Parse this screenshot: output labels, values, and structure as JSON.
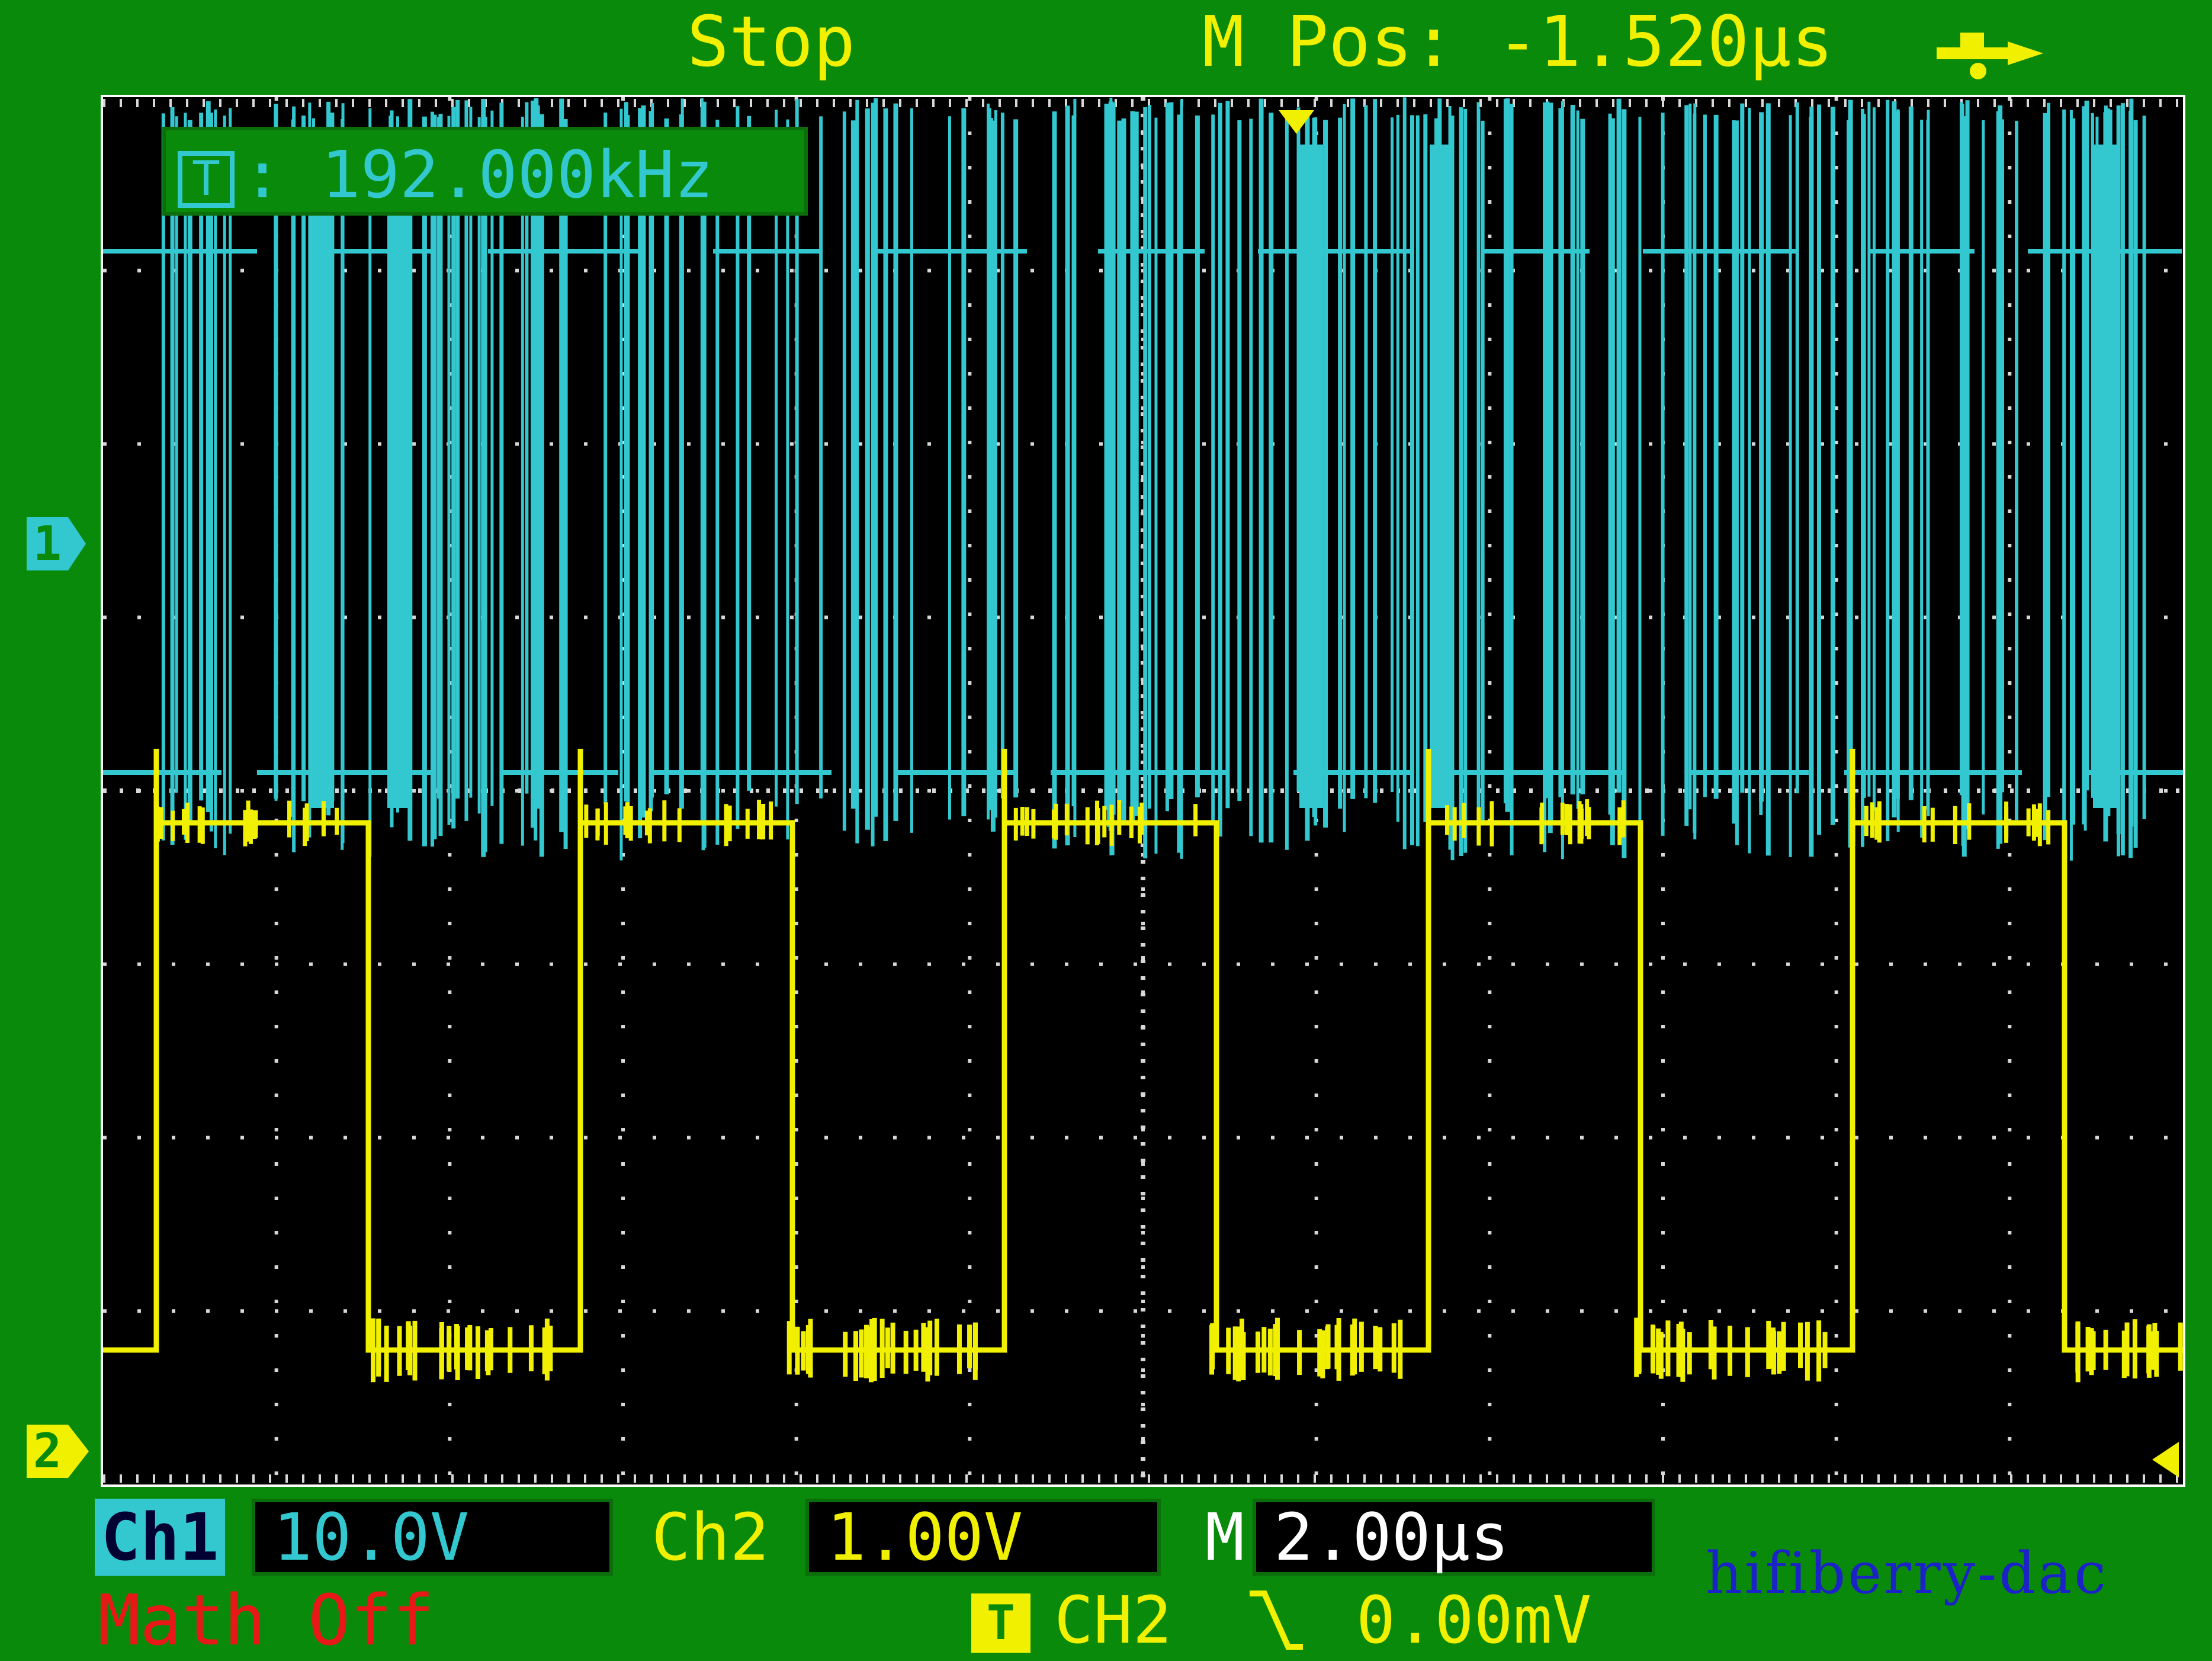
{
  "header": {
    "run_state": "Stop",
    "m_pos": "M Pos: -1.520µs",
    "usb_icon": "usb-icon"
  },
  "screen": {
    "freq_mark": "T",
    "freq_sep": ":",
    "frequency": "192.000kHz",
    "ch1_marker": "1",
    "ch2_marker": "2",
    "trigger_pos_icon": "trigger-position-arrow-icon",
    "trigger_level_icon": "trigger-level-arrow-icon"
  },
  "footer": {
    "ch1_label": "Ch1",
    "ch1_scale": "10.0V",
    "ch2_label": "Ch2",
    "ch2_scale": "1.00V",
    "m_label": "M",
    "m_scale": "2.00µs",
    "math": "Math Off",
    "trig_icon": "T",
    "trig_source": "CH2",
    "trig_slope_icon": "falling-edge-icon",
    "trig_level": "0.00mV",
    "watermark": "hifiberry-dac"
  },
  "colors": {
    "background": "#0a8a0a",
    "ch1": "#33c8d0",
    "ch2": "#f0f000",
    "math": "#e81818",
    "watermark": "#1a22c8"
  }
}
